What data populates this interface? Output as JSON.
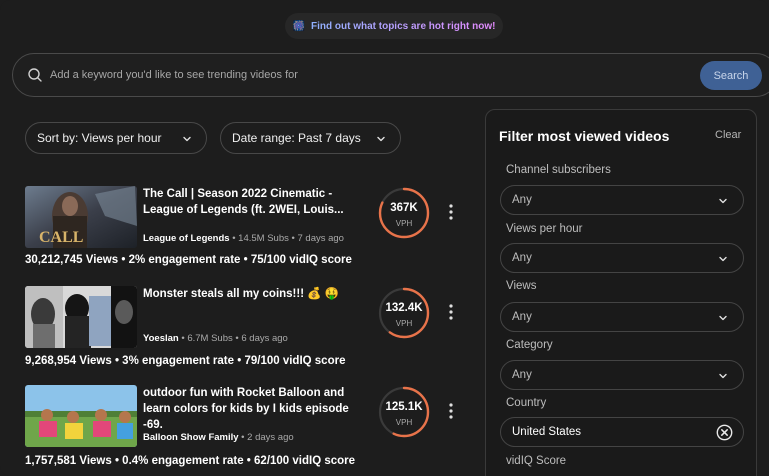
{
  "banner": {
    "emoji": "🎆",
    "text": "Find out what topics are hot right now!"
  },
  "search": {
    "placeholder": "Add a keyword you'd like to see trending videos for",
    "button_label": "Search"
  },
  "sort": {
    "label": "Sort by: Views per hour"
  },
  "date_range": {
    "label": "Date range: Past 7 days"
  },
  "videos": [
    {
      "title": "The Call | Season 2022 Cinematic - League of Legends (ft. 2WEI, Louis...",
      "channel": "League of Legends",
      "meta": " • 14.5M Subs • 7 days ago",
      "views": "30,212,745 Views",
      "engagement": "2% engagement rate",
      "score": "75/100 vidIQ score",
      "vph_value": "367K",
      "vph_label": "VPH",
      "vph_fraction": 0.82
    },
    {
      "title": "Monster steals all my coins!!! 💰 🤑",
      "channel": "Yoeslan",
      "meta": " • 6.7M Subs • 6 days ago",
      "views": "9,268,954 Views",
      "engagement": "3% engagement rate",
      "score": "79/100 vidIQ score",
      "vph_value": "132.4K",
      "vph_label": "VPH",
      "vph_fraction": 0.6
    },
    {
      "title": "outdoor fun with Rocket Balloon and learn colors for kids by I kids episode -69.",
      "channel": "Balloon Show Family",
      "meta": " • 2 days ago",
      "views": "1,757,581 Views",
      "engagement": "0.4% engagement rate",
      "score": "62/100 vidIQ score",
      "vph_value": "125.1K",
      "vph_label": "VPH",
      "vph_fraction": 0.57
    }
  ],
  "separator": " • ",
  "filters": {
    "title": "Filter most viewed videos",
    "clear_label": "Clear",
    "channel_subscribers": {
      "label": "Channel subscribers",
      "value": "Any"
    },
    "views_per_hour": {
      "label": "Views per hour",
      "value": "Any"
    },
    "views": {
      "label": "Views",
      "value": "Any"
    },
    "category": {
      "label": "Category",
      "value": "Any"
    },
    "country": {
      "label": "Country",
      "value": "United States"
    },
    "vidiq_score": {
      "label": "vidIQ Score"
    }
  },
  "colors": {
    "accent_orange": "#e8734a",
    "search_button": "#3f6195",
    "background": "#1d1d1d"
  }
}
